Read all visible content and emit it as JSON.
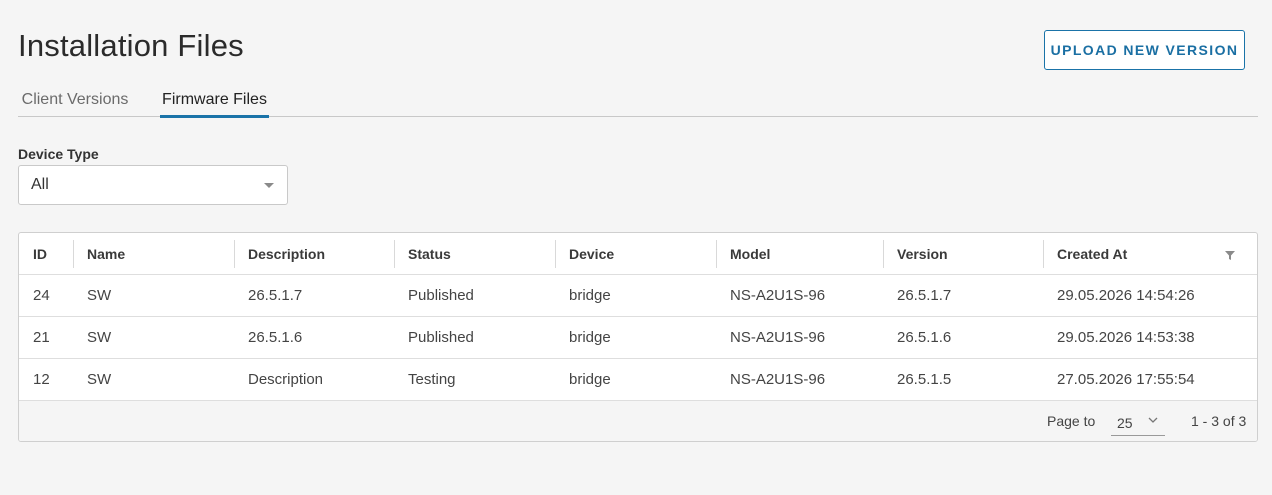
{
  "page": {
    "title": "Installation Files",
    "upload_button": "UPLOAD NEW VERSION"
  },
  "tabs": [
    {
      "label": "Client Versions",
      "active": false
    },
    {
      "label": "Firmware Files",
      "active": true
    }
  ],
  "filter": {
    "label": "Device Type",
    "selected": "All"
  },
  "table": {
    "columns": [
      "ID",
      "Name",
      "Description",
      "Status",
      "Device",
      "Model",
      "Version",
      "Created At"
    ],
    "rows": [
      {
        "id": "24",
        "name": "SW",
        "description": "26.5.1.7",
        "status": "Published",
        "device": "bridge",
        "model": "NS-A2U1S-96",
        "version": "26.5.1.7",
        "created_at": "29.05.2026 14:54:26"
      },
      {
        "id": "21",
        "name": "SW",
        "description": "26.5.1.6",
        "status": "Published",
        "device": "bridge",
        "model": "NS-A2U1S-96",
        "version": "26.5.1.6",
        "created_at": "29.05.2026 14:53:38"
      },
      {
        "id": "12",
        "name": "SW",
        "description": "Description",
        "status": "Testing",
        "device": "bridge",
        "model": "NS-A2U1S-96",
        "version": "26.5.1.5",
        "created_at": "27.05.2026 17:55:54"
      }
    ]
  },
  "pagination": {
    "label": "Page to",
    "page_size": "25",
    "range": "1 - 3 of 3"
  },
  "colors": {
    "accent": "#1a73a8",
    "background": "#f5f5f5"
  }
}
